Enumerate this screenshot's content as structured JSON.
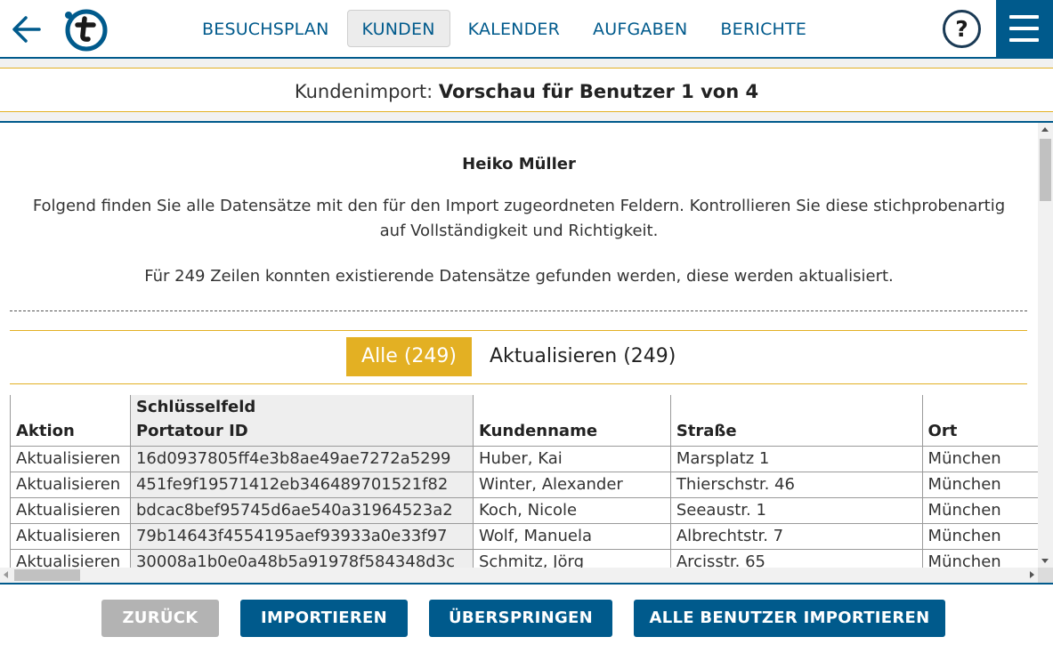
{
  "nav": {
    "tabs": [
      {
        "label": "BESUCHSPLAN"
      },
      {
        "label": "KUNDEN"
      },
      {
        "label": "KALENDER"
      },
      {
        "label": "AUFGABEN"
      },
      {
        "label": "BERICHTE"
      }
    ],
    "active_tab": "KUNDEN",
    "help_label": "?"
  },
  "page": {
    "title_prefix": "Kundenimport:",
    "title_bold": "Vorschau für Benutzer 1 von 4"
  },
  "content": {
    "user_name": "Heiko Müller",
    "intro_line1": "Folgend finden Sie alle Datensätze mit den für den Import zugeordneten Feldern. Kontrollieren Sie diese stichprobenartig",
    "intro_line2": "auf Vollständigkeit und Richtigkeit.",
    "found_text": "Für 249 Zeilen konnten existierende Datensätze gefunden werden, diese werden aktualisiert."
  },
  "filters": {
    "all_label": "Alle (249)",
    "update_label": "Aktualisieren (249)"
  },
  "table": {
    "headers": {
      "action": "Aktion",
      "key_top": "Schlüsselfeld",
      "key_bottom": "Portatour ID",
      "name": "Kundenname",
      "street": "Straße",
      "city": "Ort"
    },
    "rows": [
      {
        "action": "Aktualisieren",
        "id": "16d0937805ff4e3b8ae49ae7272a5299",
        "name": "Huber, Kai",
        "street": "Marsplatz 1",
        "city": "München"
      },
      {
        "action": "Aktualisieren",
        "id": "451fe9f19571412eb346489701521f82",
        "name": "Winter, Alexander",
        "street": "Thierschstr. 46",
        "city": "München"
      },
      {
        "action": "Aktualisieren",
        "id": "bdcac8bef95745d6ae540a31964523a2",
        "name": "Koch, Nicole",
        "street": "Seeaustr. 1",
        "city": "München"
      },
      {
        "action": "Aktualisieren",
        "id": "79b14643f4554195aef93933a0e33f97",
        "name": "Wolf, Manuela",
        "street": "Albrechtstr. 7",
        "city": "München"
      },
      {
        "action": "Aktualisieren",
        "id": "30008a1b0e0a48b5a91978f584348d3c",
        "name": "Schmitz, Jörg",
        "street": "Arcisstr. 65",
        "city": "München"
      }
    ]
  },
  "footer": {
    "back_label": "ZURÜCK",
    "import_label": "IMPORTIEREN",
    "skip_label": "ÜBERSPRINGEN",
    "import_all_label": "ALLE BENUTZER IMPORTIEREN"
  },
  "colors": {
    "brand_blue": "#005a8c",
    "accent_gold": "#e3b023",
    "disabled_gray": "#b3b3b3"
  },
  "icons": {
    "back": "arrow-left-icon",
    "logo": "portatour-logo",
    "help": "question-icon",
    "menu": "hamburger-menu-icon"
  }
}
